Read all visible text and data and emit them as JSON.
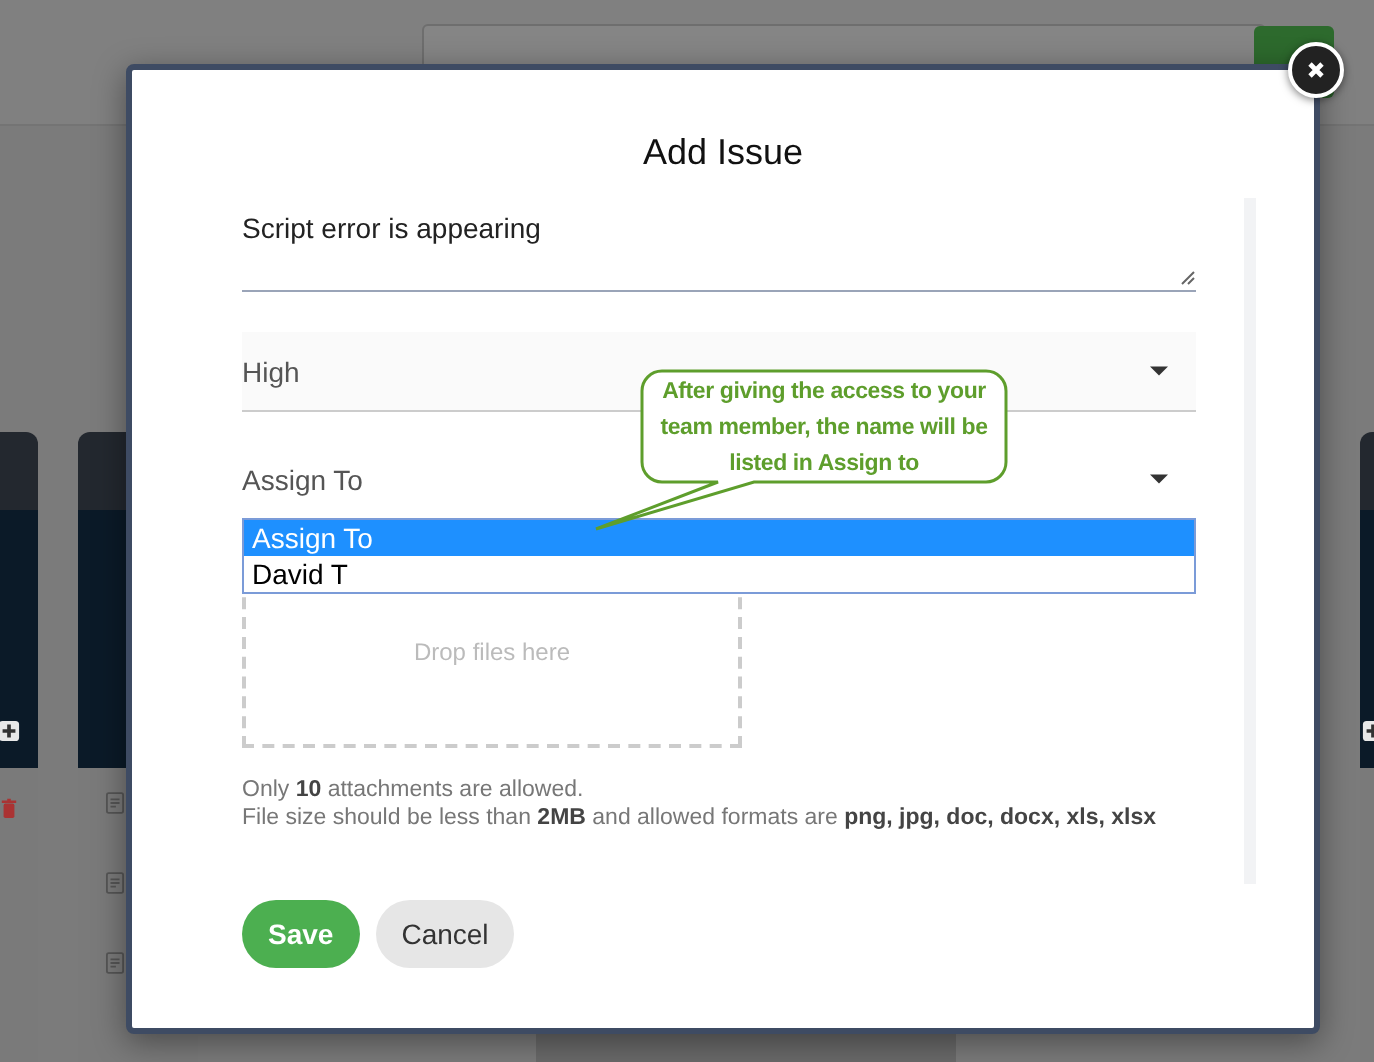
{
  "modal": {
    "title": "Add Issue",
    "description": "Script error is appearing",
    "priority": "High",
    "assignee_placeholder": "Assign To",
    "assignee_options": [
      {
        "label": "Assign To",
        "selected": true
      },
      {
        "label": "David T",
        "selected": false
      }
    ],
    "dropzone": "Drop files here",
    "notes": [
      "Only **10** attachments are allowed.",
      "File size should be less than **2MB** and allowed formats are **png, jpg, doc, docx, xls, xlsx**"
    ],
    "buttons": [
      {
        "label": "Save",
        "kind": "primary"
      },
      {
        "label": "Cancel",
        "kind": "secondary"
      }
    ]
  },
  "callout": "After giving the access to your team member, the name will be listed in Assign to"
}
